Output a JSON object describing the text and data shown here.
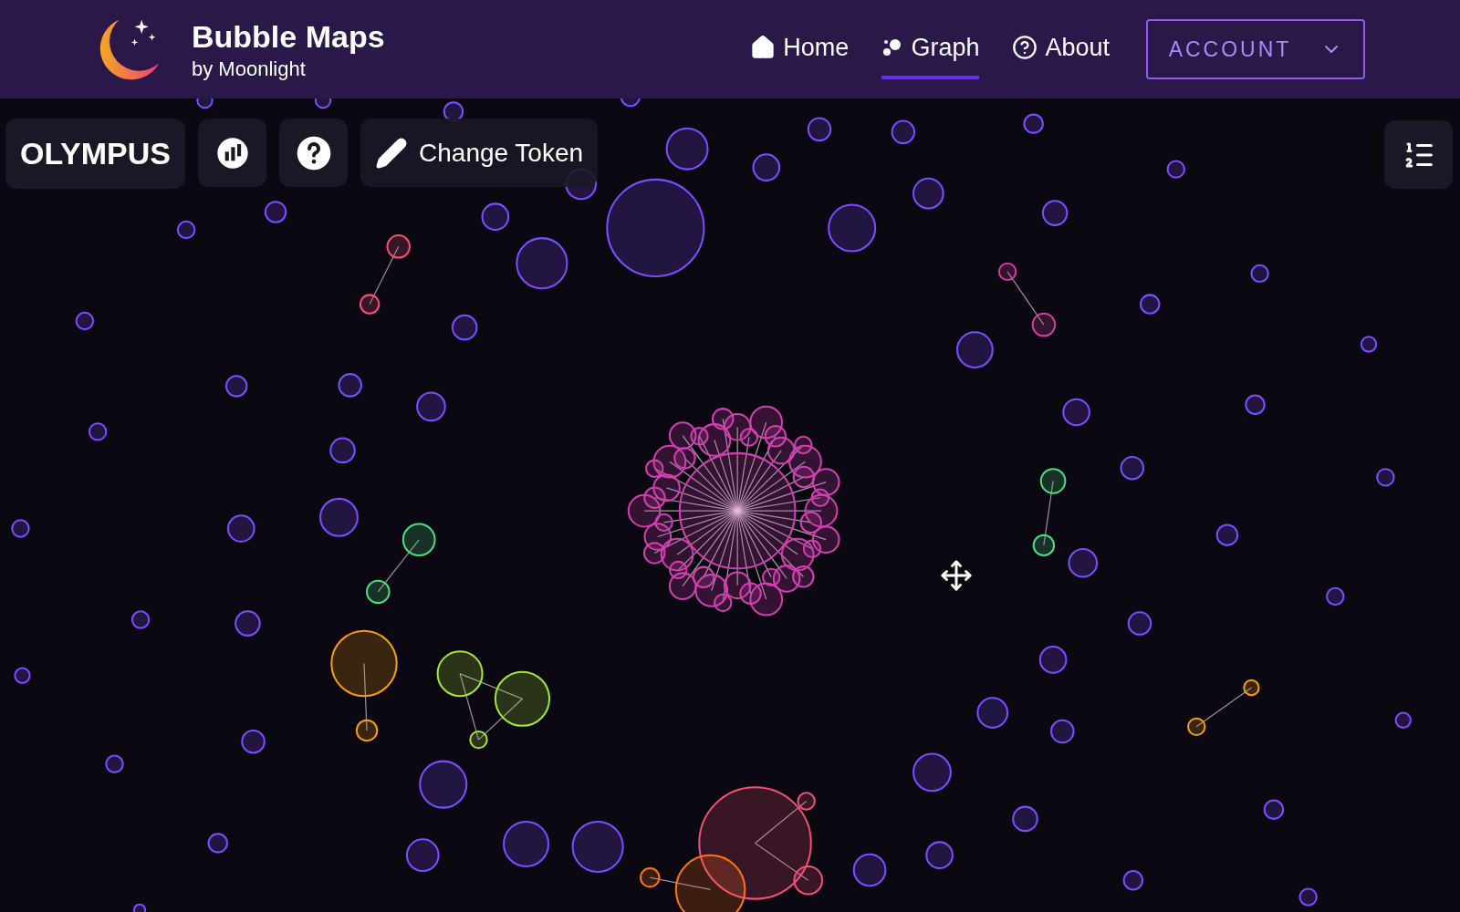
{
  "brand": {
    "title": "Bubble Maps",
    "subtitle": "by Moonlight"
  },
  "nav": [
    {
      "kind": "home",
      "label": "Home",
      "selected": false
    },
    {
      "kind": "graph",
      "label": "Graph",
      "selected": true
    },
    {
      "kind": "about",
      "label": "About",
      "selected": false
    }
  ],
  "account_button": {
    "label": "ACCOUNT"
  },
  "toolbar": {
    "token": "OLYMPUS",
    "change_token": "Change Token"
  }
}
